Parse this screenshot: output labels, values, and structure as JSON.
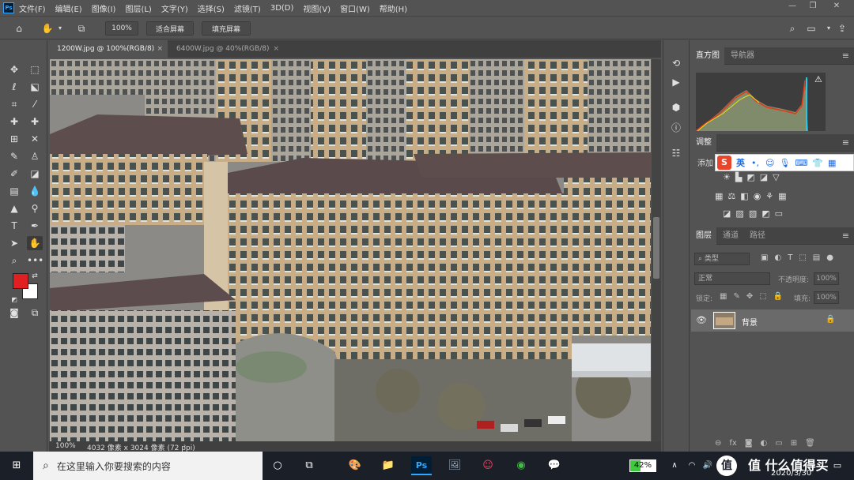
{
  "menubar": {
    "items": [
      "文件(F)",
      "编辑(E)",
      "图像(I)",
      "图层(L)",
      "文字(Y)",
      "选择(S)",
      "滤镜(T)",
      "3D(D)",
      "视图(V)",
      "窗口(W)",
      "帮助(H)"
    ]
  },
  "options": {
    "zoom_value": "100%",
    "fit_screen": "适合屏幕",
    "fill_screen": "填充屏幕"
  },
  "tabs": [
    {
      "label": "1200W.jpg @ 100%(RGB/8)"
    },
    {
      "label": "6400W.jpg @ 40%(RGB/8)"
    }
  ],
  "statusbar": {
    "zoom": "100%",
    "doc_info": "4032 像素 x 3024 像素 (72 ppi)"
  },
  "histogram_panel": {
    "tab_histogram": "直方图",
    "tab_navigator": "导航器"
  },
  "adjustments_panel": {
    "title": "调整",
    "add_label": "添加"
  },
  "ime": {
    "mode": "英"
  },
  "layers_panel": {
    "tab_layers": "图层",
    "tab_channels": "通道",
    "tab_paths": "路径",
    "filter_label": "类型",
    "blend_mode": "正常",
    "opacity_label": "不透明度:",
    "opacity_value": "100%",
    "lock_label": "锁定:",
    "fill_label": "填充:",
    "fill_value": "100%",
    "layer_name": "背景"
  },
  "taskbar": {
    "search_placeholder": "在这里输入你要搜索的内容",
    "battery": "42%",
    "date": "2020/3/30",
    "watermark": "值 什么值得买"
  },
  "colors": {
    "foreground": "#e02020",
    "background": "#ffffff",
    "ps_blue": "#31a8ff"
  }
}
